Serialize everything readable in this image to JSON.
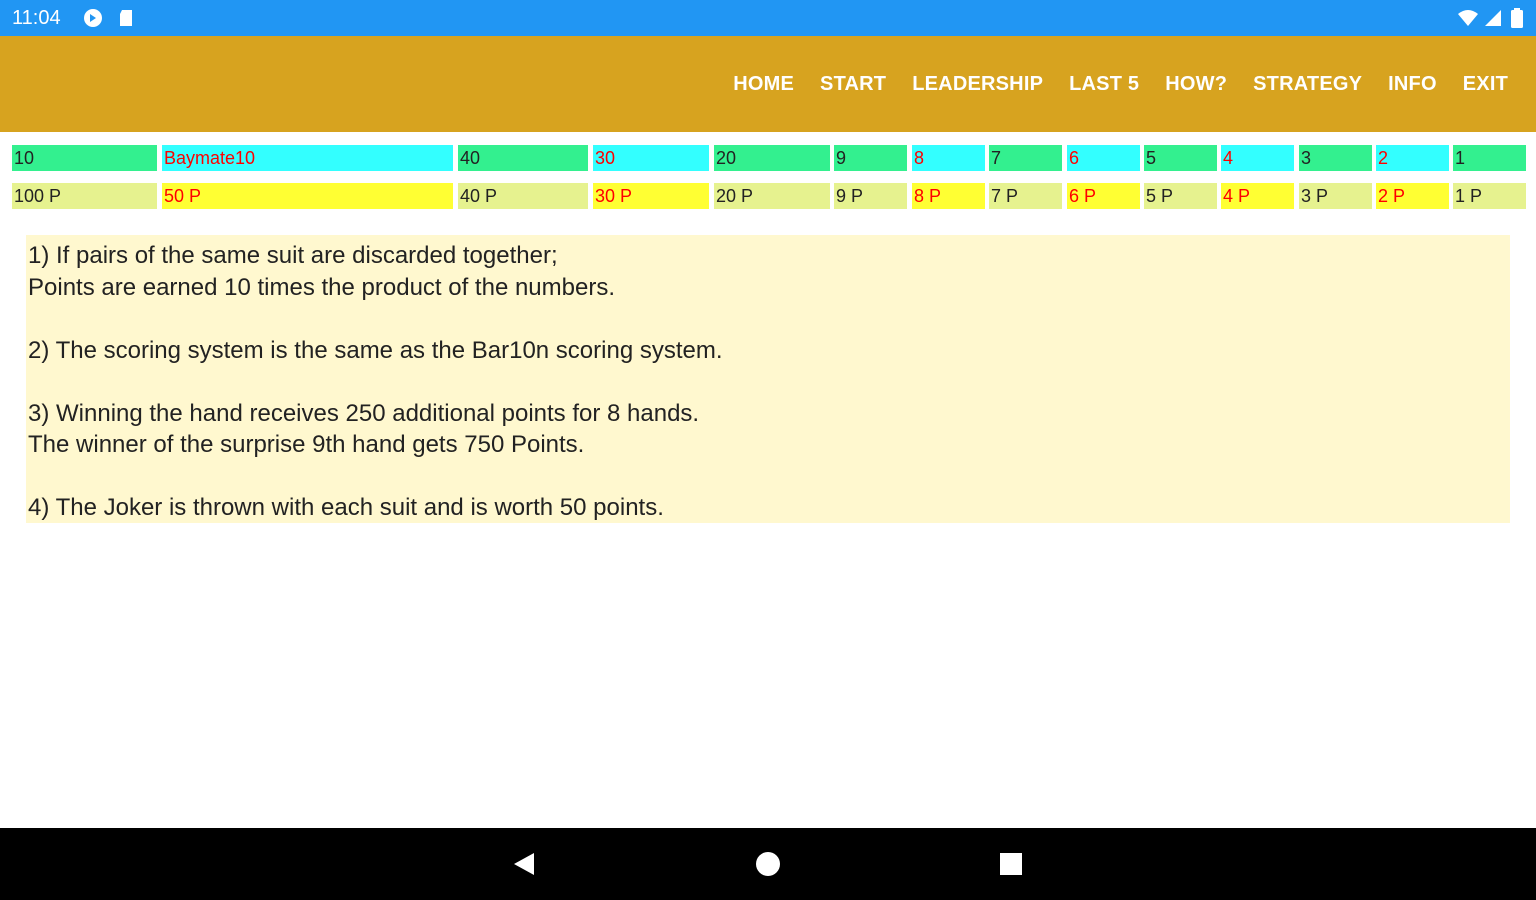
{
  "status_bar": {
    "time": "11:04",
    "icons_left": [
      "sync-icon",
      "sd-card-icon"
    ],
    "icons_right": [
      "wifi-icon",
      "signal-icon",
      "battery-icon"
    ]
  },
  "app_bar": {
    "color": "#d7a31f",
    "menu": [
      "HOME",
      "START",
      "LEADERSHIP",
      "LAST 5",
      "HOW?",
      "STRATEGY",
      "INFO",
      "EXIT"
    ]
  },
  "score_table": {
    "colors": {
      "green": "#33f08f",
      "cyan": "#33ffff",
      "yellow": "#ffff33",
      "light": "#e6f28f",
      "red": "#ff0000",
      "dark": "#222222"
    },
    "top_row": [
      "10",
      "Baymate10",
      "40",
      "30",
      "20",
      "9",
      "8",
      "7",
      "6",
      "5",
      "4",
      "3",
      "2",
      "1"
    ],
    "bottom_row": [
      "100 P",
      "50 P",
      "40 P",
      "30 P",
      "20 P",
      "9 P",
      "8 P",
      "7 P",
      "6 P",
      "5 P",
      "4 P",
      "3 P",
      "2 P",
      "1 P"
    ]
  },
  "rules": [
    "1) If pairs of the same suit are discarded together;",
    "Points are earned 10 times the product of the numbers.",
    "",
    "2) The scoring system is the same as the Bar10n scoring system.",
    "",
    "3) Winning the hand receives 250 additional points for 8 hands.",
    "The winner of the surprise 9th hand gets 750 Points.",
    "",
    "4) The Joker is thrown with each suit and is worth 50 points."
  ],
  "nav_bar": {
    "buttons": [
      "back-icon",
      "home-icon",
      "recents-icon"
    ]
  }
}
